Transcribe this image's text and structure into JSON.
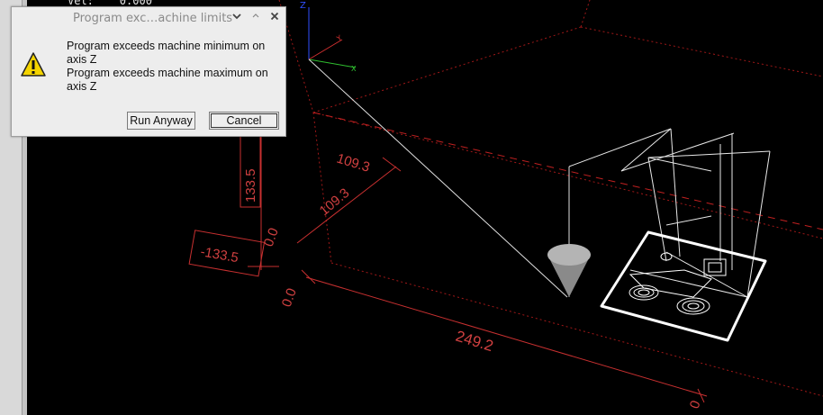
{
  "status": {
    "vel_text": "Vel:    0.000"
  },
  "dialog": {
    "title": "Program exc…achine limits",
    "line1": "Program exceeds machine minimum on",
    "line2": "axis Z",
    "line3": "Program exceeds machine maximum on",
    "line4": "axis Z",
    "run_label": "Run Anyway",
    "cancel_label": "Cancel",
    "icons": [
      "warning-icon",
      "chevron-down-icon",
      "chevron-up-icon",
      "close-icon"
    ]
  },
  "preview": {
    "axis_labels": {
      "z": "Z",
      "y": "Y",
      "x": "X"
    },
    "dimensions": {
      "y_extent": "109.3",
      "y_extent_2": "109.3",
      "z_max": "133.5",
      "z_min": "-133.5",
      "zero_a": "0.0",
      "zero_b": "0.0",
      "x_extent": "249.2",
      "x_end": "0"
    },
    "colors": {
      "limit_lines": "#c02020",
      "dimension_text": "#d04040",
      "toolpath": "#ffffff",
      "axis_x": "#30c030",
      "axis_y": "#d03030",
      "axis_z": "#3050ff"
    }
  }
}
